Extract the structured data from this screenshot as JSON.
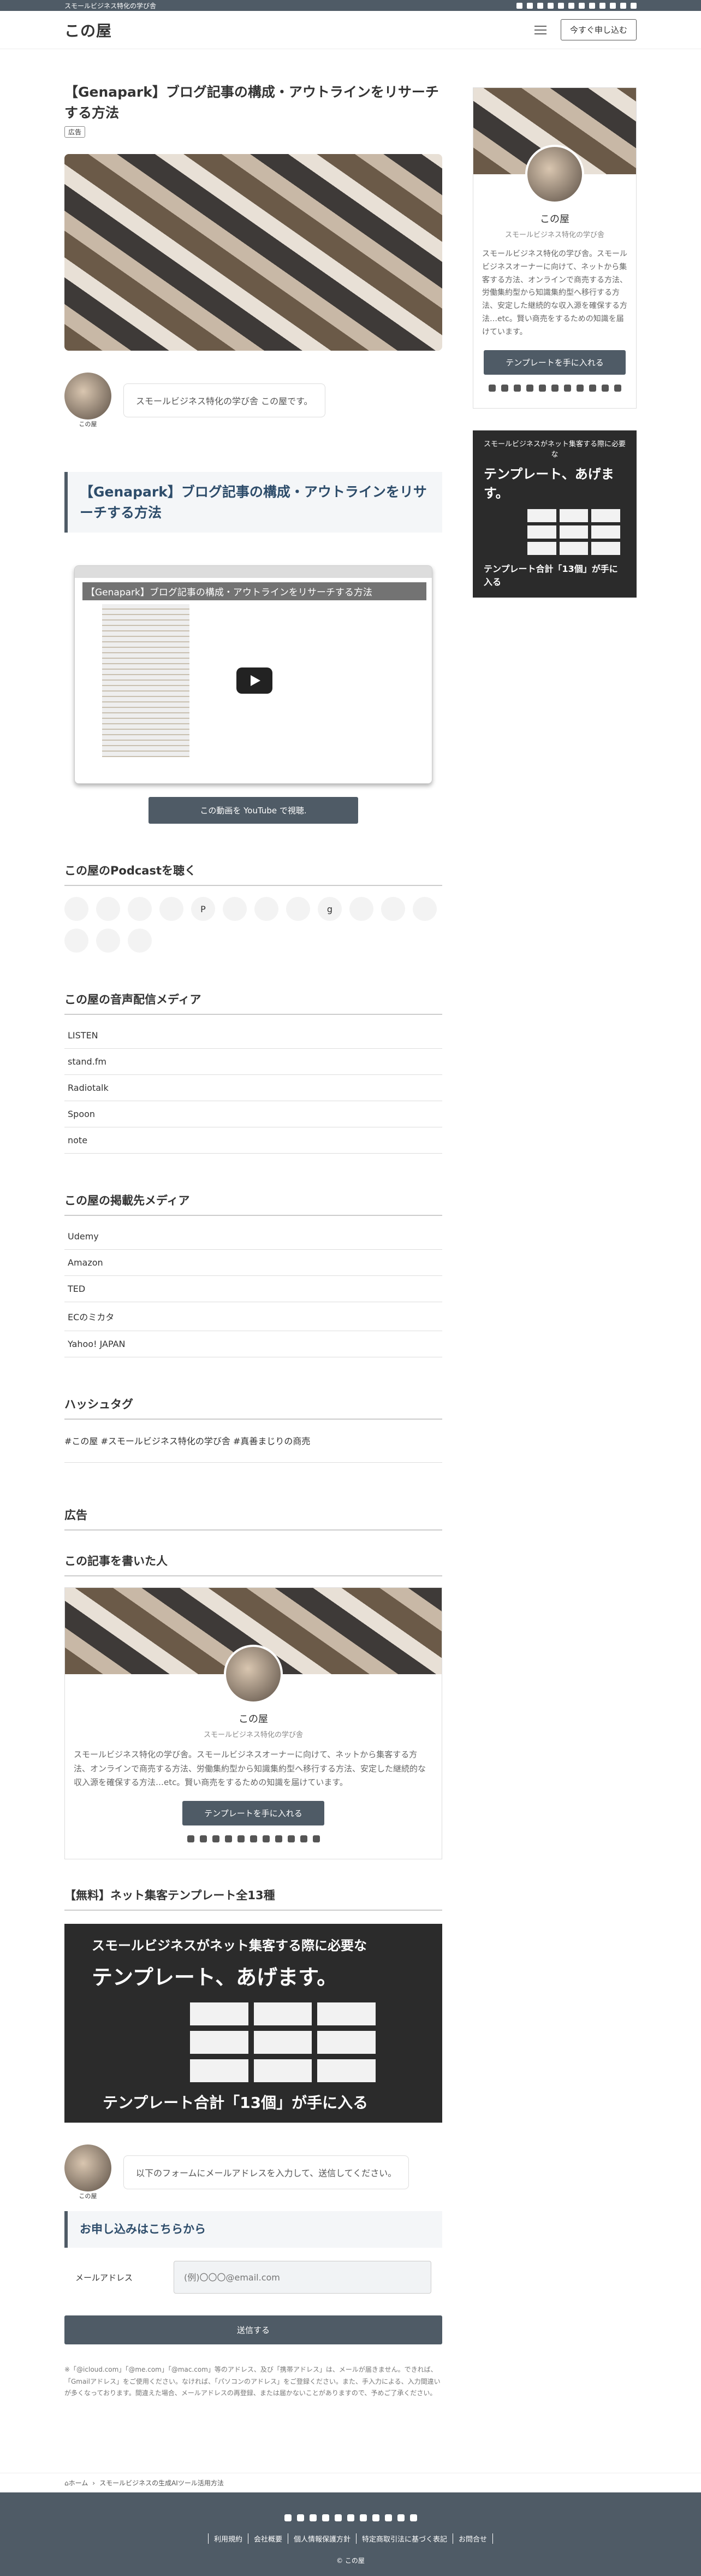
{
  "topbar": {
    "tagline": "スモールビジネス特化の学び舎"
  },
  "header": {
    "logo": "この屋",
    "cta": "今すぐ申し込む"
  },
  "post": {
    "title": "【Genapark】ブログ記事の構成・アウトラインをリサーチする方法",
    "tag": "広告",
    "author_name": "この屋",
    "bubble": "スモールビジネス特化の学び舎 この屋です。"
  },
  "section": {
    "heading": "【Genapark】ブログ記事の構成・アウトラインをリサーチする方法"
  },
  "video": {
    "title": "【Genapark】ブログ記事の構成・アウトラインをリサーチする方法",
    "button": "この動画を YouTube で視聴."
  },
  "podcast": {
    "heading": "この屋のPodcastを聴く",
    "items": [
      "",
      "",
      "",
      "",
      "P",
      "",
      "",
      "",
      "g",
      "",
      "",
      "",
      "",
      "",
      ""
    ]
  },
  "audio_media": {
    "heading": "この屋の音声配信メディア",
    "items": [
      "LISTEN",
      "stand.fm",
      "Radiotalk",
      "Spoon",
      "note"
    ]
  },
  "publish_media": {
    "heading": "この屋の掲載先メディア",
    "items": [
      "Udemy",
      "Amazon",
      "TED",
      "ECのミカタ",
      "Yahoo! JAPAN"
    ]
  },
  "hashtag": {
    "heading": "ハッシュタグ",
    "text": "#この屋 #スモールビジネス特化の学び舎 #真善まじりの商売"
  },
  "ad": {
    "heading": "広告"
  },
  "author": {
    "heading": "この記事を書いた人",
    "name": "この屋",
    "sub": "スモールビジネス特化の学び舎",
    "desc": "スモールビジネス特化の学び舎。スモールビジネスオーナーに向けて、ネットから集客する方法、オンラインで商売する方法、労働集約型から知識集約型へ移行する方法、安定した継続的な収入源を確保する方法…etc。賢い商売をするための知識を届けています。",
    "button": "テンプレートを手に入れる"
  },
  "template": {
    "heading": "【無料】ネット集客テンプレート全13種",
    "banner_top": "スモールビジネスがネット集客する際に必要な",
    "banner_main": "テンプレート、あげます。",
    "banner_bottom": "テンプレート合計「13個」が手に入る"
  },
  "form_intro": {
    "bubble": "以下のフォームにメールアドレスを入力して、送信してください。",
    "author": "この屋"
  },
  "form": {
    "heading": "お申し込みはこちらから",
    "label": "メールアドレス",
    "placeholder": "(例)〇〇〇@email.com",
    "submit": "送信する",
    "note": "※「@icloud.com」「@me.com」「@mac.com」等のアドレス、及び「携帯アドレス」は、メールが届きません。できれば、「Gmailアドレス」をご使用ください。なければ、「パソコンのアドレス」をご登録ください。また、手入力による、入力間違いが多くなっております。間違えた場合、メールアドレスの再登録、または届かないことがありますので、予めご了承ください。"
  },
  "sidebar": {
    "name": "この屋",
    "sub": "スモールビジネス特化の学び舎",
    "desc": "スモールビジネス特化の学び舎。スモールビジネスオーナーに向けて、ネットから集客する方法、オンラインで商売する方法、労働集約型から知識集約型へ移行する方法、安定した継続的な収入源を確保する方法…etc。賢い商売をするための知識を届けています。",
    "button": "テンプレートを手に入れる",
    "banner_top": "スモールビジネスがネット集客する際に必要な",
    "banner_main": "テンプレート、あげます。",
    "banner_bottom": "テンプレート合計「13個」が手に入る"
  },
  "breadcrumb": {
    "home": "ホーム",
    "sep": "›",
    "current": "スモールビジネスの生成AIツール活用方法"
  },
  "footer": {
    "links": [
      "利用規約",
      "会社概要",
      "個人情報保護方針",
      "特定商取引法に基づく表記",
      "お問合せ"
    ],
    "copyright": "© この屋"
  }
}
